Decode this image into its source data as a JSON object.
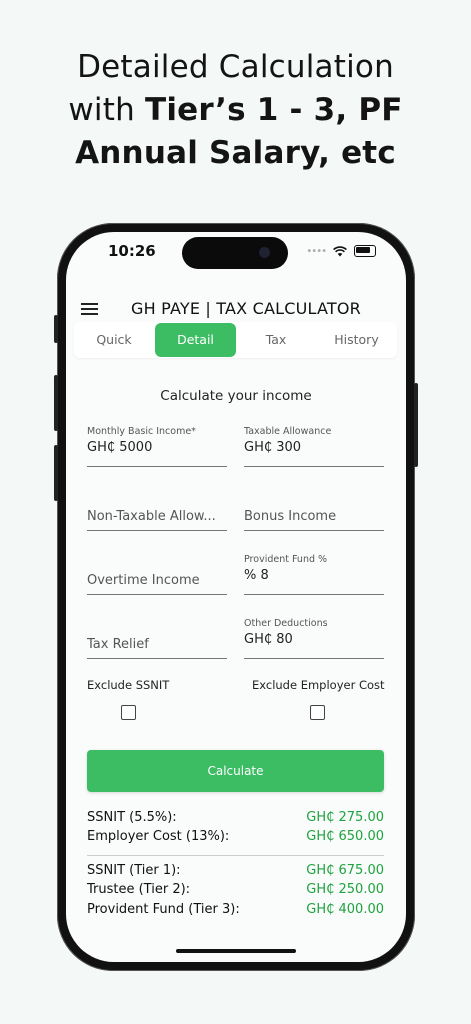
{
  "headline": {
    "line1": "Detailed Calculation",
    "line2_plain": "with ",
    "line2_bold": "Tier’s 1 - 3, PF",
    "line3_bold": "Annual Salary, etc"
  },
  "status_bar": {
    "time": "10:26",
    "signal_dots": "••••"
  },
  "app": {
    "title": "GH PAYE | TAX CALCULATOR"
  },
  "tabs": [
    {
      "label": "Quick",
      "active": false
    },
    {
      "label": "Detail",
      "active": true
    },
    {
      "label": "Tax",
      "active": false
    },
    {
      "label": "History",
      "active": false
    }
  ],
  "form": {
    "title": "Calculate your income",
    "monthly_basic": {
      "label": "Monthly Basic Income*",
      "value": "GH₵ 5000"
    },
    "taxable_allowance": {
      "label": "Taxable Allowance",
      "value": "GH₵ 300"
    },
    "non_taxable_allowance": {
      "placeholder": "Non-Taxable Allow..."
    },
    "bonus_income": {
      "placeholder": "Bonus Income"
    },
    "overtime_income": {
      "placeholder": "Overtime Income"
    },
    "provident_fund": {
      "label": "Provident Fund %",
      "value": "% 8"
    },
    "tax_relief": {
      "placeholder": "Tax Relief"
    },
    "other_deductions": {
      "label": "Other Deductions",
      "value": "GH₵ 80"
    },
    "exclude_ssnit": {
      "label": "Exclude SSNIT",
      "checked": false
    },
    "exclude_employer_cost": {
      "label": "Exclude Employer Cost",
      "checked": false
    },
    "calculate_label": "Calculate"
  },
  "results": {
    "group1": [
      {
        "label": "SSNIT (5.5%):",
        "value": "GH₵ 275.00"
      },
      {
        "label": "Employer Cost (13%):",
        "value": "GH₵ 650.00"
      }
    ],
    "group2": [
      {
        "label": "SSNIT (Tier 1):",
        "value": "GH₵ 675.00"
      },
      {
        "label": "Trustee (Tier 2):",
        "value": "GH₵ 250.00"
      },
      {
        "label": "Provident Fund (Tier 3):",
        "value": "GH₵ 400.00"
      }
    ]
  },
  "colors": {
    "accent": "#3dbd63",
    "value_green": "#1fa33f",
    "background": "#f4f8f7"
  },
  "icons": [
    "menu-icon",
    "wifi-icon",
    "battery-icon",
    "checkbox-icon"
  ]
}
